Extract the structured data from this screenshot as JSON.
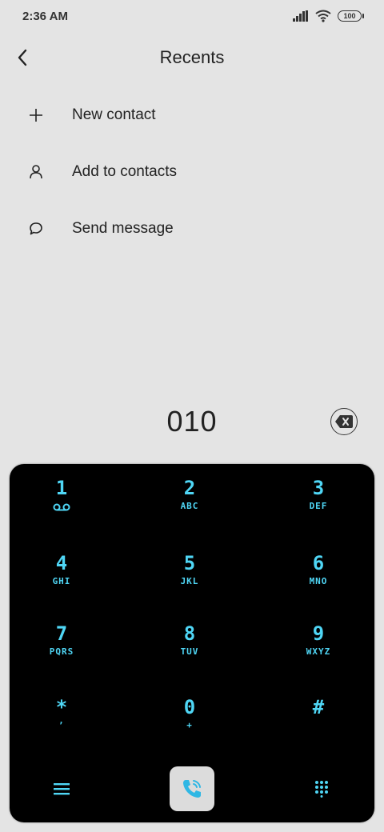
{
  "status_bar": {
    "time": "2:36 AM",
    "battery": "100"
  },
  "header": {
    "title": "Recents"
  },
  "menu": {
    "items": [
      {
        "label": "New contact",
        "icon": "plus-icon"
      },
      {
        "label": "Add to contacts",
        "icon": "person-icon"
      },
      {
        "label": "Send message",
        "icon": "message-bubble-icon"
      }
    ]
  },
  "dialer": {
    "number": "010",
    "keys": [
      {
        "digit": "1",
        "letters": ""
      },
      {
        "digit": "2",
        "letters": "ABC"
      },
      {
        "digit": "3",
        "letters": "DEF"
      },
      {
        "digit": "4",
        "letters": "GHI"
      },
      {
        "digit": "5",
        "letters": "JKL"
      },
      {
        "digit": "6",
        "letters": "MNO"
      },
      {
        "digit": "7",
        "letters": "PQRS"
      },
      {
        "digit": "8",
        "letters": "TUV"
      },
      {
        "digit": "9",
        "letters": "WXYZ"
      },
      {
        "digit": "*",
        "letters": ","
      },
      {
        "digit": "0",
        "letters": "+"
      },
      {
        "digit": "#",
        "letters": ""
      }
    ]
  },
  "colors": {
    "keypad_accent": "#4fd6f5",
    "background": "#e4e4e4",
    "keypad_bg": "#000000"
  }
}
